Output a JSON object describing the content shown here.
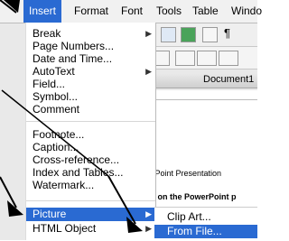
{
  "menubar": {
    "items": [
      "Insert",
      "Format",
      "Font",
      "Tools",
      "Table",
      "Windo"
    ],
    "active": "Insert"
  },
  "insert_menu": {
    "items": [
      "Break",
      "Page Numbers...",
      "Date and Time...",
      "AutoText",
      "Field...",
      "Symbol...",
      "Comment",
      "Footnote...",
      "Caption...",
      "Cross-reference...",
      "Index and Tables...",
      "Watermark...",
      "Picture",
      "HTML Object"
    ],
    "has_submenu": [
      "Break",
      "AutoText",
      "Picture",
      "HTML Object"
    ],
    "selected": "Picture"
  },
  "picture_submenu": {
    "items": [
      "Clip Art...",
      "From File..."
    ],
    "selected": "From File..."
  },
  "document": {
    "window_title": "Document1",
    "line1": "owerPoint Presentation",
    "line2_prefix": "click on the PowerPoint p"
  },
  "colors": {
    "highlight": "#2a6ad2",
    "menubar_bg": "#f1f1f1"
  }
}
